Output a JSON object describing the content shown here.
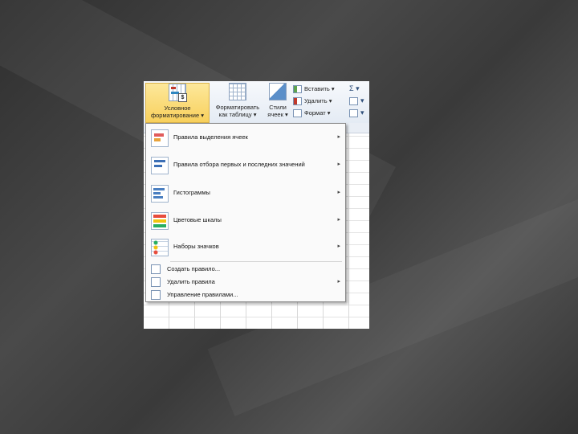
{
  "ribbon": {
    "conditional_formatting": {
      "line1": "Условное",
      "line2": "форматирование ▾"
    },
    "format_as_table": {
      "line1": "Форматировать",
      "line2": "как таблицу ▾"
    },
    "cell_styles": {
      "line1": "Стили",
      "line2": "ячеек ▾"
    },
    "cells": {
      "insert": "Вставить ▾",
      "delete": "Удалить ▾",
      "format": "Формат ▾"
    },
    "editing": {
      "sum": "Σ ▾",
      "fill": "▾",
      "clear": "▾"
    }
  },
  "menu": {
    "items": [
      {
        "label": "Правила выделения ячеек",
        "arrow": "▸"
      },
      {
        "label": "Правила отбора первых и последних значений",
        "arrow": "▸"
      },
      {
        "label": "Гистограммы",
        "arrow": "▸"
      },
      {
        "label": "Цветовые шкалы",
        "arrow": "▸"
      },
      {
        "label": "Наборы значков",
        "arrow": "▸"
      }
    ],
    "small_items": [
      {
        "label": "Создать правило..."
      },
      {
        "label": "Удалить правила",
        "arrow": "▸"
      },
      {
        "label": "Управление правилами..."
      }
    ]
  }
}
